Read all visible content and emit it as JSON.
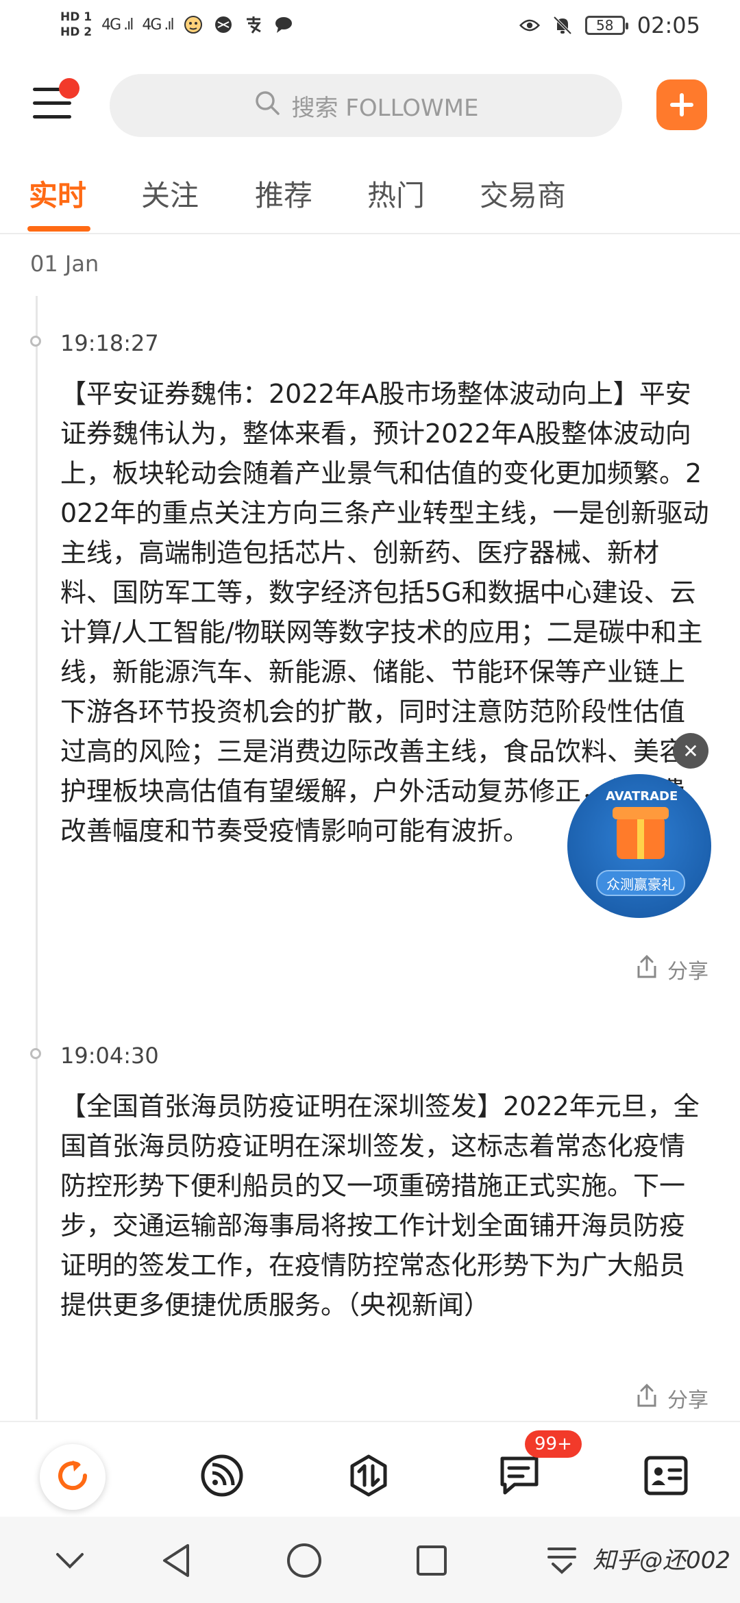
{
  "status_bar": {
    "hd_top": "HD 1",
    "hd_bottom": "HD 2",
    "signal_1": "4G .ıl",
    "signal_2": "4G .ıl",
    "battery": "58",
    "time": "02:05"
  },
  "header": {
    "search_placeholder": "搜索 FOLLOWME"
  },
  "tabs": [
    {
      "label": "实时",
      "active": true
    },
    {
      "label": "关注",
      "active": false
    },
    {
      "label": "推荐",
      "active": false
    },
    {
      "label": "热门",
      "active": false
    },
    {
      "label": "交易商",
      "active": false
    }
  ],
  "feed": {
    "date": "01 Jan",
    "items": [
      {
        "time": "19:18:27",
        "text": "【平安证券魏伟：2022年A股市场整体波动向上】平安证券魏伟认为，整体来看，预计2022年A股整体波动向上，板块轮动会随着产业景气和估值的变化更加频繁。2022年的重点关注方向三条产业转型主线，一是创新驱动主线，高端制造包括芯片、创新药、医疗器械、新材料、国防军工等，数字经济包括5G和数据中心建设、云计算/人工智能/物联网等数字技术的应用；二是碳中和主线，新能源汽车、新能源、储能、节能环保等产业链上下游各环节投资机会的扩散，同时注意防范阶段性估值过高的风险；三是消费边际改善主线，食品饮料、美容护理板块高估值有望缓解，户外活动复苏修正，但消费改善幅度和节奏受疫情影响可能有波折。",
        "share": "分享"
      },
      {
        "time": "19:04:30",
        "text": "【全国首张海员防疫证明在深圳签发】2022年元旦，全国首张海员防疫证明在深圳签发，这标志着常态化疫情防控形势下便利船员的又一项重磅措施正式实施。下一步，交通运输部海事局将按工作计划全面铺开海员防疫证明的签发工作，在疫情防控常态化形势下为广大船员提供更多便捷优质服务。（央视新闻）",
        "share": "分享"
      }
    ]
  },
  "ad": {
    "brand": "AVATRADE",
    "label": "众测赢豪礼"
  },
  "bottom_nav": {
    "badge": "99+"
  },
  "watermark": "知乎@还002",
  "colors": {
    "accent": "#ff6a14",
    "badge": "#f23a2a"
  }
}
